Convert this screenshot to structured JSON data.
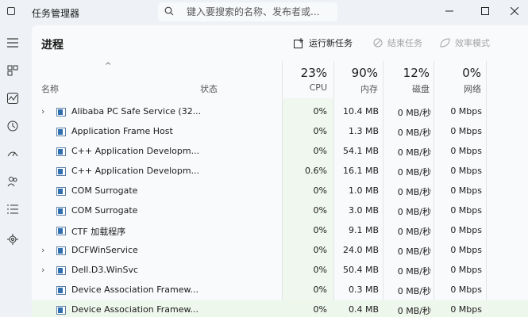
{
  "window": {
    "title": "任务管理器",
    "search_placeholder": "键入要搜索的名称、发布者或..."
  },
  "toolbar": {
    "page_title": "进程",
    "run_new_task": "运行新任务",
    "end_task": "结束任务",
    "efficiency_mode": "效率模式"
  },
  "columns": {
    "sort_indicator": "^",
    "name": "名称",
    "status": "状态",
    "cpu": {
      "percent": "23%",
      "label": "CPU"
    },
    "memory": {
      "percent": "90%",
      "label": "内存"
    },
    "disk": {
      "percent": "12%",
      "label": "磁盘"
    },
    "network": {
      "percent": "0%",
      "label": "网络"
    }
  },
  "processes": [
    {
      "expandable": true,
      "name": "Alibaba PC Safe Service (32...",
      "cpu": "0%",
      "memory": "10.4 MB",
      "disk": "0 MB/秒",
      "network": "0 Mbps"
    },
    {
      "expandable": false,
      "name": "Application Frame Host",
      "cpu": "0%",
      "memory": "1.3 MB",
      "disk": "0 MB/秒",
      "network": "0 Mbps"
    },
    {
      "expandable": false,
      "name": "C++ Application Developm...",
      "cpu": "0%",
      "memory": "54.1 MB",
      "disk": "0 MB/秒",
      "network": "0 Mbps"
    },
    {
      "expandable": false,
      "name": "C++ Application Developm...",
      "cpu": "0.6%",
      "memory": "16.1 MB",
      "disk": "0 MB/秒",
      "network": "0 Mbps"
    },
    {
      "expandable": false,
      "name": "COM Surrogate",
      "cpu": "0%",
      "memory": "1.0 MB",
      "disk": "0 MB/秒",
      "network": "0 Mbps"
    },
    {
      "expandable": false,
      "name": "COM Surrogate",
      "cpu": "0%",
      "memory": "3.0 MB",
      "disk": "0 MB/秒",
      "network": "0 Mbps"
    },
    {
      "expandable": false,
      "name": "CTF 加载程序",
      "cpu": "0%",
      "memory": "9.1 MB",
      "disk": "0 MB/秒",
      "network": "0 Mbps"
    },
    {
      "expandable": true,
      "name": "DCFWinService",
      "cpu": "0%",
      "memory": "24.0 MB",
      "disk": "0 MB/秒",
      "network": "0 Mbps"
    },
    {
      "expandable": true,
      "name": "Dell.D3.WinSvc",
      "cpu": "0%",
      "memory": "50.4 MB",
      "disk": "0 MB/秒",
      "network": "0 Mbps"
    },
    {
      "expandable": false,
      "name": "Device Association Framew...",
      "cpu": "0%",
      "memory": "0.3 MB",
      "disk": "0 MB/秒",
      "network": "0 Mbps"
    },
    {
      "expandable": false,
      "name": "Device Association Framew...",
      "cpu": "0%",
      "memory": "0.4 MB",
      "disk": "0 MB/秒",
      "network": "0 Mbps"
    }
  ]
}
